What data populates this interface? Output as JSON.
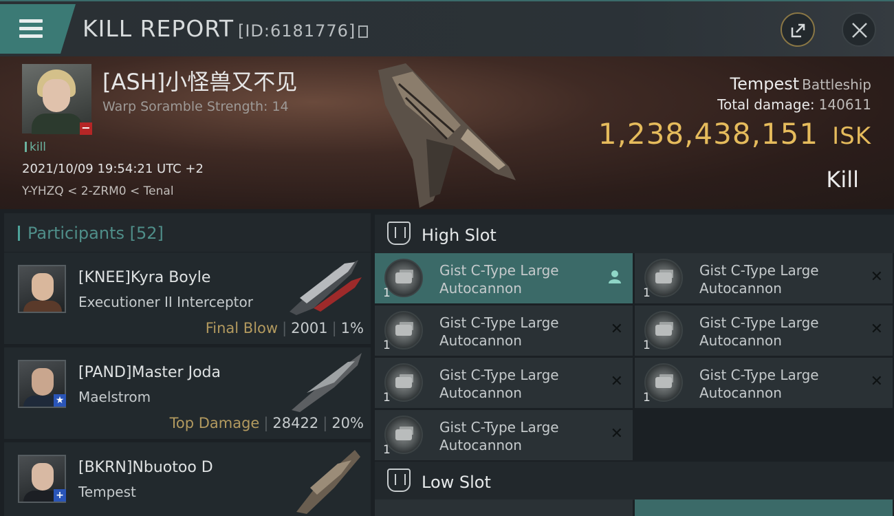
{
  "header": {
    "title": "KILL REPORT",
    "report_id": "[ID:6181776]"
  },
  "victim": {
    "name": "[ASH]小怪兽又不见",
    "warp_scramble": "Warp Soramble Strength: 14",
    "kill_tag": "kill",
    "datetime": "2021/10/09 19:54:21 UTC +2",
    "location": "Y-YHZQ < 2-ZRM0 < Tenal",
    "ship_name": "Tempest",
    "ship_class": "Battleship",
    "total_damage_label": "Total damage:",
    "total_damage": "140611",
    "isk_value": "1,238,438,151",
    "isk_unit": "ISK",
    "result": "Kill"
  },
  "participants": {
    "label": "Participants",
    "count": "[52]",
    "rows": [
      {
        "name": "[KNEE]Kyra Boyle",
        "ship": "Executioner II Interceptor",
        "tag": "Final Blow",
        "damage": "2001",
        "percent": "1%"
      },
      {
        "name": "[PAND]Master Joda",
        "ship": "Maelstrom",
        "tag": "Top Damage",
        "damage": "28422",
        "percent": "20%"
      },
      {
        "name": "[BKRN]Nbuotoo D",
        "ship": "Tempest"
      }
    ]
  },
  "high_slot": {
    "label": "High Slot",
    "modules": [
      {
        "name": "Gist C-Type Large Autocannon",
        "qty": "1"
      },
      {
        "name": "Gist C-Type Large Autocannon",
        "qty": "1"
      },
      {
        "name": "Gist C-Type Large Autocannon",
        "qty": "1"
      },
      {
        "name": "Gist C-Type Large Autocannon",
        "qty": "1"
      },
      {
        "name": "Gist C-Type Large Autocannon",
        "qty": "1"
      },
      {
        "name": "Gist C-Type Large Autocannon",
        "qty": "1"
      },
      {
        "name": "Gist C-Type Large Autocannon",
        "qty": "1"
      }
    ]
  },
  "low_slot": {
    "label": "Low Slot"
  },
  "colors": {
    "accent_teal": "#3b7a75",
    "isk_gold": "#e5bb5c",
    "tag_gold": "#b39a5f"
  },
  "icons": [
    "menu-icon",
    "copy-icon",
    "share-icon",
    "close-icon",
    "high-slot-icon",
    "low-slot-icon",
    "person-icon",
    "destroyed-x-icon"
  ]
}
